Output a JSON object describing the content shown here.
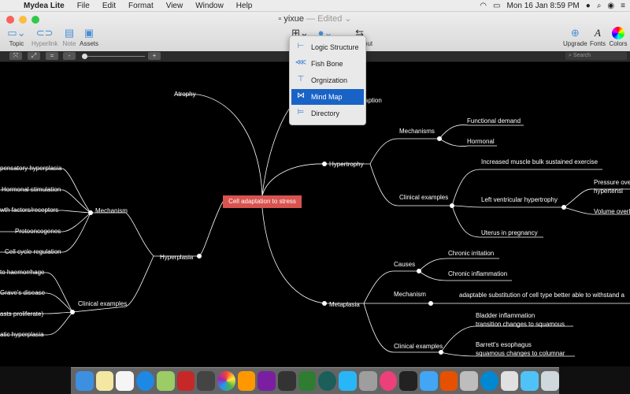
{
  "menubar": {
    "app": "Mydea Lite",
    "items": [
      "File",
      "Edit",
      "Format",
      "View",
      "Window",
      "Help"
    ],
    "datetime": "Mon 16 Jan  8:59 PM"
  },
  "window": {
    "title": "yixue",
    "edited": "— Edited ⌄"
  },
  "toolbar": {
    "topic": "Topic",
    "hyperlink": "Hyperlink",
    "note": "Note",
    "assets": "Assets",
    "layout_partial": "out",
    "upgrade": "Upgrade",
    "fonts": "Fonts",
    "colors": "Colors"
  },
  "subbar": {
    "search_placeholder": "Search",
    "minus": "-",
    "plus": "+"
  },
  "layout_menu": {
    "items": [
      "Logic Structure",
      "Fish Bone",
      "Orgnization",
      "Mind Map",
      "Directory"
    ],
    "selected": "Mind Map"
  },
  "mindmap": {
    "root": "Cell adaptation to stress",
    "atrophy": "Atrophy",
    "adaptation_partial": "aption",
    "hypertrophy": {
      "label": "Hypertrophy",
      "mechanisms": "Mechanisms",
      "functional_demand": "Functional demand",
      "hormonal": "Hormonal",
      "clinical_examples": "Clinical examples",
      "increased_bulk": "Increased muscle bulk sustained exercise",
      "lvh": "Left ventricular hypertrophy",
      "pressure": "Pressure ove",
      "hypertension": "hypertensi",
      "volume": "Volume overl",
      "uterus": "Uterus in pregnancy"
    },
    "hyperplasia": {
      "label": "Hyperplasia",
      "mechanism": "Mechanism",
      "compensatory": "pensatory hyperplasia",
      "hormonal_stim": "Hormonal stimulation",
      "growth": "wth factors/receptors",
      "proto": "Protooncogenes",
      "cell_cycle": "Cell cycle regulation",
      "clinical_examples": "Clinical examples",
      "haemorrhage": "to haemorrhage",
      "graves": "Grave's disease",
      "blasts": "asts proliferate)",
      "prostatic": "atic hyperplasia"
    },
    "metaplasia": {
      "label": "Metaplasia",
      "causes": "Causes",
      "chronic_irritation": "Chronic irritation",
      "chronic_inflammation": "Chronic inflammation",
      "mechanism": "Mechanism",
      "adaptable": "adaptable substitution of cell type better able to withstand a",
      "clinical_examples": "Clinical examples",
      "bladder1": "Bladder inflammation",
      "bladder2": "transition changes to squamous",
      "barrett1": "Barrett's esophagus",
      "barrett2": "squamous changes to columnar"
    }
  },
  "colors": {
    "root_bg": "#d9534f",
    "selection": "#1a63c6",
    "canvas": "#000000",
    "line": "#ffffff"
  }
}
